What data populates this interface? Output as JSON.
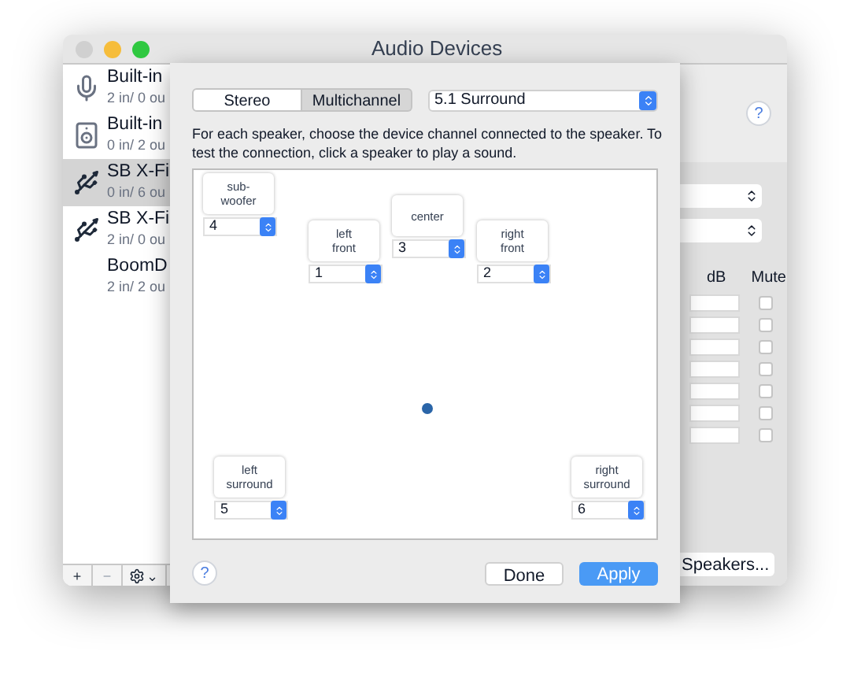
{
  "window": {
    "title": "Audio Devices"
  },
  "devices": [
    {
      "name": "Built-in",
      "channels": "2 in/ 0 ou",
      "kind": "microphone",
      "selected": false
    },
    {
      "name": "Built-in",
      "channels": "0 in/ 2 ou",
      "kind": "speaker",
      "selected": false
    },
    {
      "name": "SB X-Fi",
      "channels": "0 in/ 6 ou",
      "kind": "usb",
      "selected": true
    },
    {
      "name": "SB X-Fi",
      "channels": "2 in/ 0 ou",
      "kind": "usb",
      "selected": false
    },
    {
      "name": "BoomD",
      "channels": "2 in/ 2 ou",
      "kind": "none",
      "selected": false
    }
  ],
  "sidebar_toolbar": [
    {
      "kind": "add",
      "label": "+",
      "disabled": false
    },
    {
      "kind": "remove",
      "label": "−",
      "disabled": true
    },
    {
      "kind": "gear",
      "label": "⌄",
      "disabled": false
    }
  ],
  "right_panel": {
    "help": "?",
    "column_headers": [
      "dB",
      "Mute"
    ],
    "rows": [
      {
        "checked": false
      },
      {
        "checked": false
      },
      {
        "checked": false
      },
      {
        "checked": false
      },
      {
        "checked": false
      },
      {
        "checked": false
      },
      {
        "checked": false
      }
    ],
    "button": "Speakers..."
  },
  "sheet": {
    "tabs": [
      {
        "label": "Stereo",
        "selected": false
      },
      {
        "label": "Multichannel",
        "selected": true
      }
    ],
    "layout_popup": "5.1 Surround",
    "instructions": "For each speaker, choose the device channel connected to the speaker. To test the connection, click a speaker to play a sound.",
    "speakers": [
      {
        "label": "sub-\nwoofer",
        "channel": "4"
      },
      {
        "label": "left\nfront",
        "channel": "1"
      },
      {
        "label": "center",
        "channel": "3"
      },
      {
        "label": "right\nfront",
        "channel": "2"
      },
      {
        "label": "left\nsurround",
        "channel": "5"
      },
      {
        "label": "right\nsurround",
        "channel": "6"
      }
    ],
    "help": "?",
    "buttons": [
      {
        "label": "Done",
        "default": false
      },
      {
        "label": "Apply",
        "default": true
      }
    ]
  }
}
